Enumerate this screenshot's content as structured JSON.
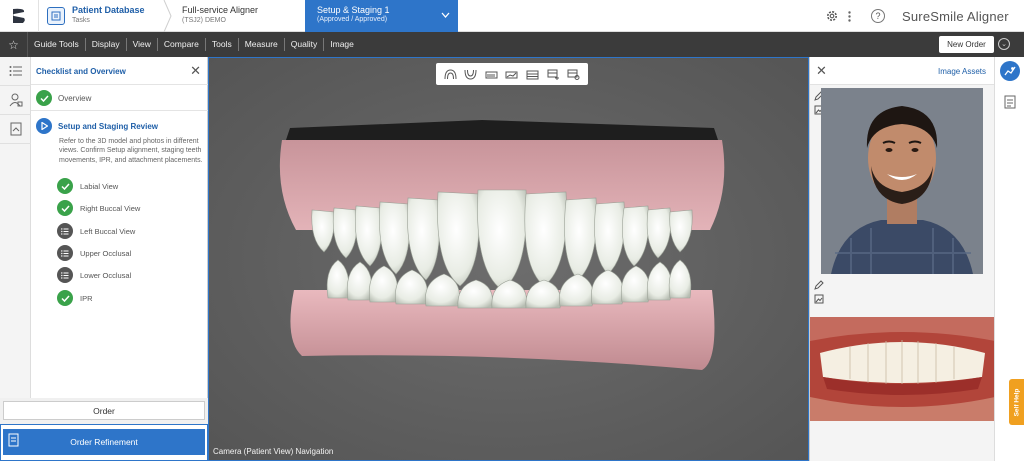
{
  "header": {
    "brand": "SureSmile Aligner",
    "breadcrumbs": [
      {
        "title": "Patient Database",
        "subtitle": "Tasks"
      },
      {
        "title": "Full-service Aligner",
        "subtitle": "(TSJ2) DEMO"
      },
      {
        "title": "Setup & Staging 1",
        "subtitle": "(Approved / Approved)"
      }
    ],
    "icons": [
      "suresmile-logo-icon",
      "gear-icon",
      "kebab-icon",
      "help-icon"
    ]
  },
  "toolbar": {
    "menu": [
      "Guide Tools",
      "Display",
      "View",
      "Compare",
      "Tools",
      "Measure",
      "Quality",
      "Image"
    ],
    "new_order": "New Order"
  },
  "checklist": {
    "title": "Checklist and Overview",
    "overview": "Overview",
    "active_step": "Setup and Staging Review",
    "description": "Refer to the 3D model and photos in different views. Confirm Setup alignment, staging teeth movements, IPR, and attachment placements.",
    "substeps": [
      {
        "label": "Labial View",
        "status": "complete"
      },
      {
        "label": "Right Buccal View",
        "status": "complete"
      },
      {
        "label": "Left Buccal View",
        "status": "pending"
      },
      {
        "label": "Upper Occlusal",
        "status": "pending"
      },
      {
        "label": "Lower Occlusal",
        "status": "pending"
      },
      {
        "label": "IPR",
        "status": "complete"
      }
    ],
    "order_button": "Order",
    "refinement_button": "Order Refinement"
  },
  "viewport": {
    "camera_label": "Camera (Patient View) Navigation",
    "view_tools": [
      "upper-arch-icon",
      "lower-arch-icon",
      "staging-icon",
      "chart-icon",
      "grid-icon",
      "grid-plus-icon",
      "settings-grid-icon"
    ]
  },
  "assets": {
    "title": "Image Assets"
  },
  "right_rail": {
    "self_help": "Self Help"
  },
  "colors": {
    "accent": "#2e75c9",
    "complete": "#3aa24a",
    "toolbar": "#3b3b3b",
    "self_help": "#f0a020"
  }
}
